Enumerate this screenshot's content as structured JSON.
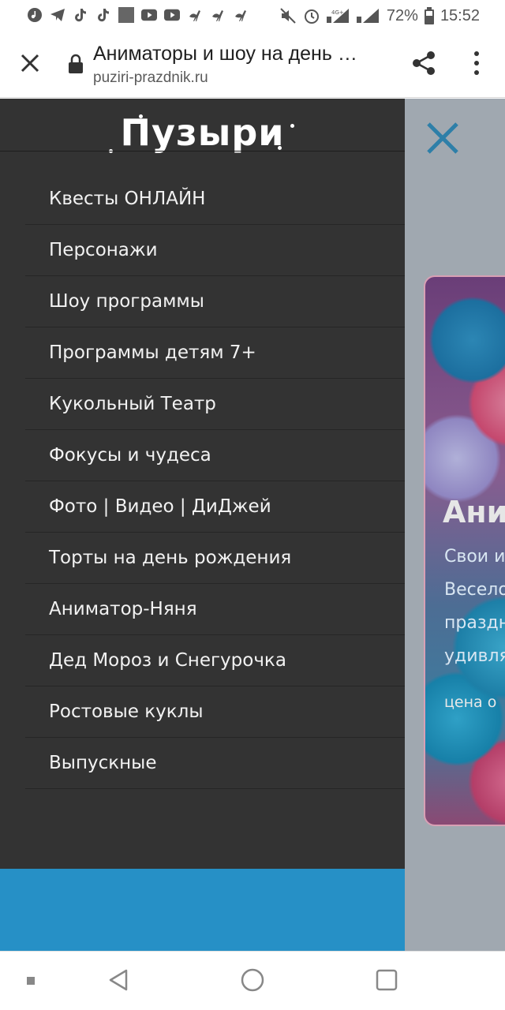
{
  "status_bar": {
    "left_icons": [
      "music-app-icon",
      "telegram-icon",
      "tiktok-icon",
      "tiktok-icon",
      "gallery-icon",
      "youtube-icon",
      "youtube-icon",
      "ostrich-icon",
      "ostrich-icon",
      "ostrich-icon"
    ],
    "network_label": "4G+",
    "battery": "72%",
    "time": "15:52"
  },
  "browser": {
    "title": "Аниматоры и шоу на день …",
    "url": "puziri-prazdnik.ru"
  },
  "drawer": {
    "logo": "Пузыри",
    "menu": [
      "Квесты ОНЛАЙН",
      "Персонажи",
      "Шоу программы",
      "Программы детям 7+",
      "Кукольный Театр",
      "Фокусы и чудеса",
      "Фото | Видео | ДиДжей",
      "Торты на день рождения",
      "Аниматор-Няня",
      "Дед Мороз и Снегурочка",
      "Ростовые куклы",
      "Выпускные"
    ]
  },
  "page": {
    "hero_title": "Ани",
    "hero_lines": [
      "Свои и",
      "Весело",
      "праздн",
      "удивля"
    ],
    "hero_price": "цена о"
  },
  "colors": {
    "drawer_bg": "#333333",
    "drawer_footer": "#2690c6",
    "page_close_icon": "#2e7fa8"
  }
}
